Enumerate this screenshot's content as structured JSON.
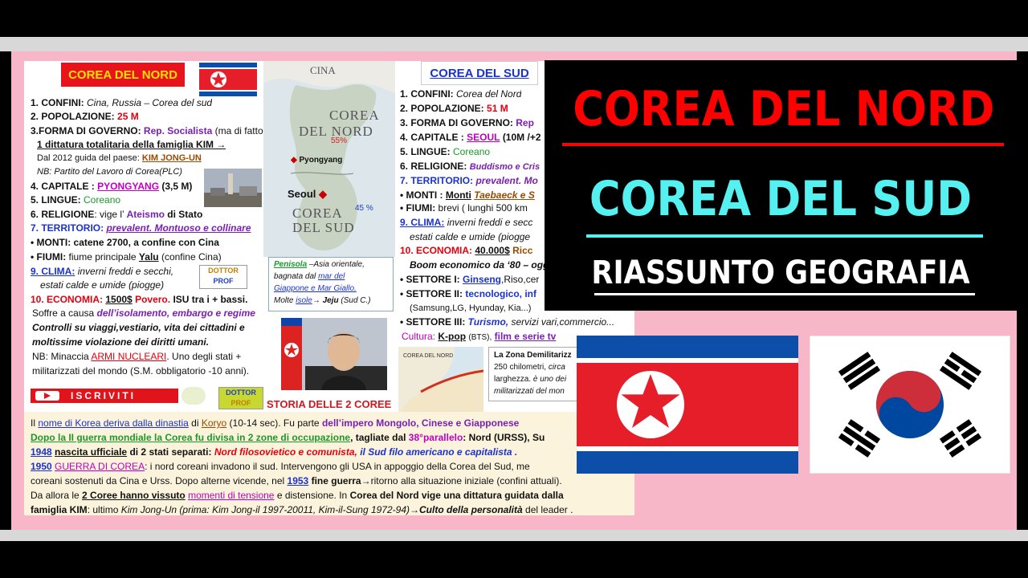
{
  "hero": {
    "line1": "COREA DEL NORD",
    "line2": "COREA DEL SUD",
    "line3": "RIASSUNTO GEOGRAFIA"
  },
  "north": {
    "title": "COREA DEL NORD",
    "l1a": "1. CONFINI:",
    "l1b": "Cina, Russia – Corea del sud",
    "l2a": "2. POPOLAZIONE:",
    "l2b": "25 M",
    "l3a": "3.FORMA DI GOVERNO:",
    "l3b": "Rep. Socialista",
    "l3c": "(ma di fatto",
    "l3d": "1 dittatura totalitaria della famiglia KIM →",
    "l3e": "Dal 2012 guida del paese:",
    "l3f": "KIM JONG-UN",
    "l3g": "NB: Partito del Lavoro di Corea(PLC)",
    "l4a": "4. CAPITALE :",
    "l4b": "PYONGYANG",
    "l4c": "(3,5 M)",
    "l5a": "5. LINGUE:",
    "l5b": "Coreano",
    "l6a": "6. RELIGIONE: vige l’",
    "l6b": "Ateismo",
    "l6c": "di Stato",
    "l7a": "7. TERRITORIO:",
    "l7b": "prevalent. Montuoso e collinare",
    "l8a": "• MONTI: catene 2700, a confine con Cina",
    "l8b": "• FIUMI: fiume principale",
    "l8c": "Yalu",
    "l8d": "(confine Cina)",
    "l9a": "9. CLIMA:",
    "l9b": "inverni freddi e secchi,",
    "l9c": "estati calde e umide (piogge)",
    "l10a": "10. ECONOMIA:",
    "l10b": "1500$",
    "l10c": "Povero.",
    "l10d": "ISU tra i + bassi.",
    "l10e": "Soffre a causa",
    "l10f": "dell’isolamento, embargo e regime",
    "l10g": "Controlli su viaggi,vestiario, vita dei cittadini e",
    "l10h": "moltissime violazione dei diritti umani.",
    "l10i": "NB: Minaccia",
    "l10j": "ARMI NUCLEARI",
    "l10k": ". Uno degli stati +",
    "l10l": "militarizzati del mondo (S.M. obbligatorio -10 anni)."
  },
  "map": {
    "cina": "CINA",
    "north_label1": "COREA",
    "north_label2": "DEL NORD",
    "south_label1": "COREA",
    "south_label2": "DEL SUD",
    "pyongyang": "Pyongyang",
    "seoul": "Seoul",
    "pct_north": "55%",
    "pct_south": "45 %",
    "note1a": "Penisola",
    "note1b": "–Asia orientale,",
    "note2a": "bagnata dal",
    "note2b": "mar del",
    "note3": "Giappone e Mar Giallo.",
    "note4a": "Molte",
    "note4b": "isole",
    "note4c": "→",
    "note4d": "Jeju",
    "note4e": "(Sud C.)"
  },
  "logos": {
    "dottor1": "DOTTOR",
    "prof1": "PROF",
    "subscribe": "ISCRIVITI",
    "dottor2": "DOTTOR",
    "prof2": "PROF",
    "storia": "STORIA DELLE 2 COREE"
  },
  "south": {
    "title": "COREA DEL SUD",
    "l1a": "1. CONFINI:",
    "l1b": "Corea del Nord",
    "l2a": "2. POPOLAZIONE:",
    "l2b": "51 M",
    "l3a": "3. FORMA DI GOVERNO:",
    "l3b": "Rep",
    "l4a": "4. CAPITALE :",
    "l4b": "SEOUL",
    "l4c": "(10M /+2",
    "l5a": "5. LINGUE:",
    "l5b": "Coreano",
    "l6a": "6. RELIGIONE:",
    "l6b": "Buddismo e Cris",
    "l7a": "7. TERRITORIO:",
    "l7b": "prevalent. Mo",
    "l8a": "• MONTI :",
    "l8b": "Monti",
    "l8c": "Taebaeck e S",
    "l8d": "• FIUMI: brevi ( lunghi 500 km",
    "l9a": "9. CLIMA:",
    "l9b": "inverni freddi e secc",
    "l9c": "estati calde e umide (piogge",
    "l10a": "10. ECONOMIA:",
    "l10b": "40.000$",
    "l10c": "Ricc",
    "l10d": "Boom economico da ‘80 – ogg",
    "l10e": "• SETTORE I:",
    "l10f": "Ginseng",
    "l10g": ",Riso,cer",
    "l10h": "• SETTORE II:",
    "l10i": "tecnologico, inf",
    "l10j": "(Samsung,LG, Hyunday, Kia...)",
    "l10k": "• SETTORE III:",
    "l10l": "Turismo,",
    "l10m": "servizi vari,commercio...",
    "l10n": "Cultura:",
    "l10o": "K-pop",
    "l10p": "(BTS),",
    "l10q": "film e serie tv"
  },
  "dmz": {
    "l1": "La Zona Demilitarizz",
    "l2a": "250 chilometri,",
    "l2b": "circa",
    "l3a": "larghezza.",
    "l3b": "è uno dei",
    "l4": "militarizzati del mon",
    "map_label": "COREA DEL NORD"
  },
  "story": {
    "p1a": "Il",
    "p1b": "nome di Korea deriva dalla dinastia",
    "p1c": "di",
    "p1d": "Koryo",
    "p1e": "(10-14 sec). Fu parte",
    "p1f": "dell’impero Mongolo, Cinese e Giapponese",
    "p2a": "Dopo la II guerra mondiale la Corea fu divisa in 2 zone di occupazione",
    "p2b": ", tagliate dal",
    "p2c": "38°parallelo",
    "p2d": ": Nord (URSS), Su",
    "p3a": "1948",
    "p3b": "nascita ufficiale",
    "p3c": "di 2 stati separati:",
    "p3d": "Nord filosovietico e comunista,",
    "p3e": "il Sud filo americano e capitalista .",
    "p4a": "1950",
    "p4b": "GUERRA DI COREA",
    "p4c": ": i nord coreani invadono il sud. Intervengono gli USA in appoggio della Corea del Sud, me",
    "p5a": "coreani sostenuti da Cina e Urss. Dopo alterne vicende, nel",
    "p5b": "1953",
    "p5c": "fine guerra",
    "p5d": "→ritorno alla situazione iniziale (confini attuali).",
    "p6a": "Da allora le",
    "p6b": "2 Coree hanno vissuto",
    "p6c": "momenti di tensione",
    "p6d": "e distensione. In",
    "p6e": "Corea del Nord vige una dittatura guidata dalla",
    "p7a": "famiglia KIM",
    "p7b": ": ultimo",
    "p7c": "Kim Jong-Un (prima: Kim Jong-il 1997-20011, Kim-il-Sung 1972-94)",
    "p7d": "→Culto della personalità",
    "p7e": "del leader ."
  },
  "colors": {
    "frame_pink": "#f7b7c8",
    "hero_red": "#ff0000",
    "hero_cyan": "#55f0f0",
    "nk_blue": "#0d4fa8",
    "nk_red": "#e51e2a",
    "sk_red": "#cd2e3a",
    "sk_blue": "#0047a0"
  }
}
